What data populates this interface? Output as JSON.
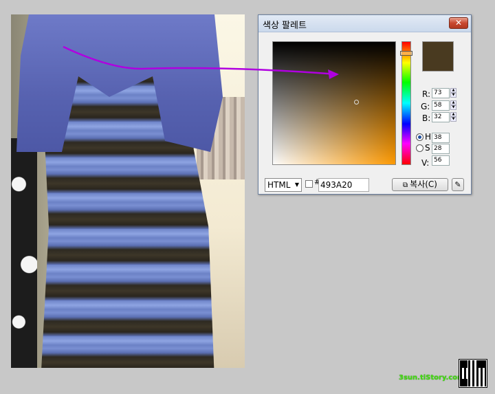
{
  "dialog": {
    "title": "색상 팔레트",
    "close_label": "✕",
    "current_color": "#493A20",
    "hue_accent": "#ff9a00",
    "rgb": [
      {
        "label": "R:",
        "value": "73"
      },
      {
        "label": "G:",
        "value": "58"
      },
      {
        "label": "B:",
        "value": "32"
      }
    ],
    "hsv": [
      {
        "label": "H",
        "value": "38",
        "selected": true
      },
      {
        "label": "S",
        "value": "28",
        "selected": false
      },
      {
        "label": "V:",
        "value": "56",
        "selected": false
      }
    ],
    "format_select": "HTML",
    "hash": "#",
    "hex_value": "493A20",
    "copy_label": "복사(C)"
  },
  "annotation": {
    "arrow_color": "#b000e0"
  },
  "watermark": {
    "text": "3sun.tiStory.com",
    "color": "#44dd11"
  }
}
